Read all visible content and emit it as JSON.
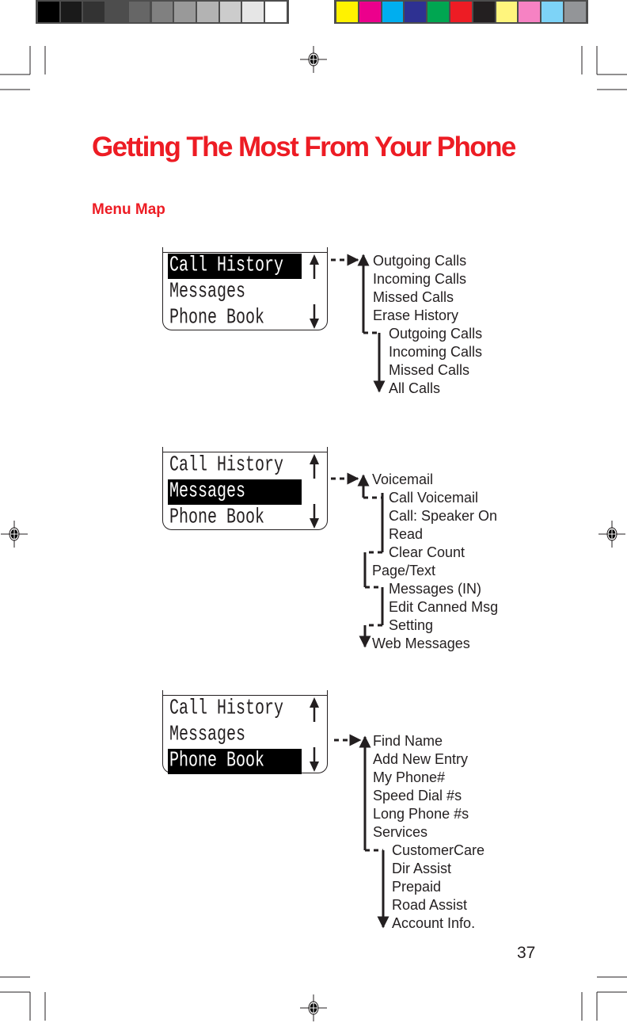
{
  "color_bar": {
    "grays": [
      "#000000",
      "#1a1a1a",
      "#333333",
      "#4d4d4d",
      "#666666",
      "#808080",
      "#999999",
      "#b3b3b3",
      "#cccccc",
      "#e6e6e6",
      "#ffffff"
    ],
    "colors": [
      "#fff200",
      "#ec008c",
      "#00aeef",
      "#2e3192",
      "#00a651",
      "#ed1c24",
      "#231f20",
      "#fff57d",
      "#f682c3",
      "#7dd3f7",
      "#939598"
    ]
  },
  "accent_color": "#ed1c24",
  "title": "Getting The Most From Your Phone",
  "subtitle": "Menu Map",
  "lcd_menu": [
    "Call History",
    "Messages",
    "Phone Book"
  ],
  "diagrams": [
    {
      "selected": 0,
      "items": [
        {
          "label": "Outgoing Calls",
          "level": 0
        },
        {
          "label": "Incoming Calls",
          "level": 0
        },
        {
          "label": "Missed Calls",
          "level": 0
        },
        {
          "label": "Erase History",
          "level": 0
        },
        {
          "label": "Outgoing Calls",
          "level": 1
        },
        {
          "label": "Incoming Calls",
          "level": 1
        },
        {
          "label": "Missed Calls",
          "level": 1
        },
        {
          "label": "All Calls",
          "level": 1
        }
      ]
    },
    {
      "selected": 1,
      "items": [
        {
          "label": "Voicemail",
          "level": 0
        },
        {
          "label": "Call Voicemail",
          "level": 1
        },
        {
          "label": "Call: Speaker On",
          "level": 1
        },
        {
          "label": "Read",
          "level": 1
        },
        {
          "label": "Clear Count",
          "level": 1
        },
        {
          "label": "Page/Text",
          "level": 0
        },
        {
          "label": "Messages (IN)",
          "level": 1
        },
        {
          "label": "Edit Canned Msg",
          "level": 1
        },
        {
          "label": "Setting",
          "level": 1
        },
        {
          "label": "Web Messages",
          "level": 0
        }
      ]
    },
    {
      "selected": 2,
      "items": [
        {
          "label": "Find Name",
          "level": 0
        },
        {
          "label": "Add New Entry",
          "level": 0
        },
        {
          "label": "My Phone#",
          "level": 0
        },
        {
          "label": "Speed Dial #s",
          "level": 0
        },
        {
          "label": "Long Phone #s",
          "level": 0
        },
        {
          "label": "Services",
          "level": 0
        },
        {
          "label": "CustomerCare",
          "level": 1
        },
        {
          "label": "Dir Assist",
          "level": 1
        },
        {
          "label": "Prepaid",
          "level": 1
        },
        {
          "label": "Road Assist",
          "level": 1
        },
        {
          "label": "Account Info.",
          "level": 1
        }
      ]
    }
  ],
  "page_number": "37"
}
